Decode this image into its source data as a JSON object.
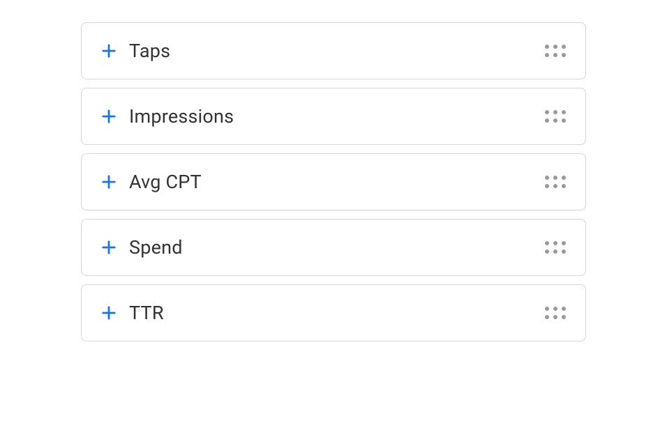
{
  "metrics": [
    {
      "label": "Taps"
    },
    {
      "label": "Impressions"
    },
    {
      "label": "Avg CPT"
    },
    {
      "label": "Spend"
    },
    {
      "label": "TTR"
    }
  ],
  "colors": {
    "accent": "#1B73E8",
    "border": "#d6d6d6",
    "text": "#333333",
    "handle": "#999999"
  }
}
